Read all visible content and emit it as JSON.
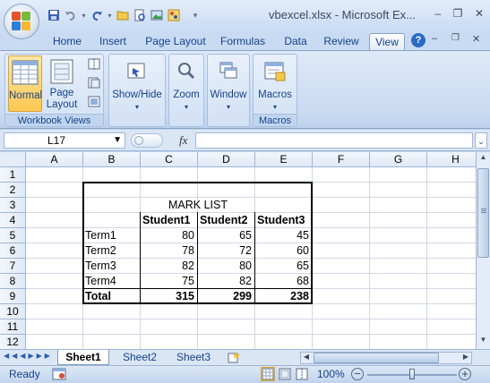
{
  "window": {
    "title": "vbexcel.xlsx - Microsoft Ex...",
    "minimize": "–",
    "restore": "❐",
    "close": "✕"
  },
  "ribbon_tabs": [
    "Home",
    "Insert",
    "Page Layout",
    "Formulas",
    "Data",
    "Review",
    "View"
  ],
  "active_tab": "View",
  "ribbon": {
    "normal": "Normal",
    "page_layout_1": "Page",
    "page_layout_2": "Layout",
    "workbook_views_label": "Workbook Views",
    "show_hide": "Show/Hide",
    "zoom": "Zoom",
    "window": "Window",
    "macros": "Macros",
    "macros_group_label": "Macros"
  },
  "formula_bar": {
    "name_box": "L17",
    "fx": "fx",
    "formula": ""
  },
  "columns": [
    "A",
    "B",
    "C",
    "D",
    "E",
    "F",
    "G",
    "H"
  ],
  "rows": [
    "1",
    "2",
    "3",
    "4",
    "5",
    "6",
    "7",
    "8",
    "9",
    "10",
    "11",
    "12"
  ],
  "sheet": {
    "table_title": "MARK LIST",
    "headers": [
      "Student1",
      "Student2",
      "Student3"
    ],
    "data_rows": [
      {
        "label": "Term1",
        "values": [
          "80",
          "65",
          "45"
        ]
      },
      {
        "label": "Term2",
        "values": [
          "78",
          "72",
          "60"
        ]
      },
      {
        "label": "Term3",
        "values": [
          "82",
          "80",
          "65"
        ]
      },
      {
        "label": "Term4",
        "values": [
          "75",
          "82",
          "68"
        ]
      }
    ],
    "total": {
      "label": "Total",
      "values": [
        "315",
        "299",
        "238"
      ]
    }
  },
  "sheet_tabs": [
    "Sheet1",
    "Sheet2",
    "Sheet3"
  ],
  "active_sheet": "Sheet1",
  "status": {
    "ready": "Ready",
    "zoom": "100%",
    "zoom_level_percent": 100
  },
  "colors": {
    "ribbon_blue": "#15428b",
    "active_button": "#fbc752",
    "grid_line": "#d0d7e5"
  }
}
